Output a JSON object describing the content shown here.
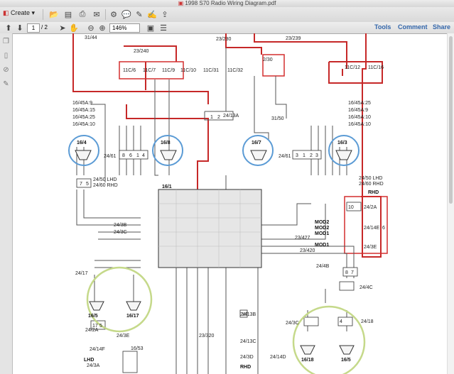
{
  "window": {
    "title": "1998 S70 Radio Wiring Diagram.pdf"
  },
  "toolbar": {
    "create_label": "Create",
    "page_current": "1",
    "page_total": "/ 2",
    "zoom": "146%",
    "tools_label": "Tools",
    "comment_label": "Comment",
    "share_label": "Share"
  },
  "diagram": {
    "top_labels": [
      "31/44",
      "23/240",
      "23/230",
      "23/239",
      "2/30",
      "11C/6",
      "11C/7",
      "11C/9",
      "11C/10",
      "11C/31",
      "11C/32",
      "11C/12",
      "11C/16"
    ],
    "left_signals": [
      "16/45A:9",
      "16/45A:15",
      "16/45A:25",
      "16/45A:10"
    ],
    "right_signals": [
      "16/45A:25",
      "16/45A:9",
      "16/45A:10",
      "16/45A:10"
    ],
    "speakers": [
      "16/4",
      "16/8",
      "16/7",
      "16/3",
      "16/5",
      "16/17",
      "16/18",
      "16/5"
    ],
    "components": [
      "24/13A",
      "31/50",
      "24/61",
      "24/61",
      "24/50 LHD",
      "24/60 RHD",
      "24/50 LHD",
      "24/60 RHD",
      "16/1",
      "24/3B",
      "24/3C",
      "24/2A",
      "24/14E",
      "24/3E",
      "24/4B",
      "24/4C",
      "23/427",
      "23/420",
      "24/17",
      "24/2A",
      "24/3E",
      "24/14F",
      "16/53",
      "24/3A",
      "24/13B",
      "24/13C",
      "24/3D",
      "24/14D",
      "23/320",
      "24/3C",
      "24/18",
      "RHD",
      "LHD",
      "RHD"
    ],
    "modules": [
      "MOD2",
      "MOD2",
      "MOD1",
      "MOD1"
    ],
    "connectors": [
      "1",
      "2",
      "7",
      "5",
      "8",
      "6",
      "1",
      "4",
      "3",
      "1",
      "2",
      "3",
      "10",
      "6",
      "8",
      "7",
      "14",
      "17",
      "5",
      "4"
    ]
  }
}
